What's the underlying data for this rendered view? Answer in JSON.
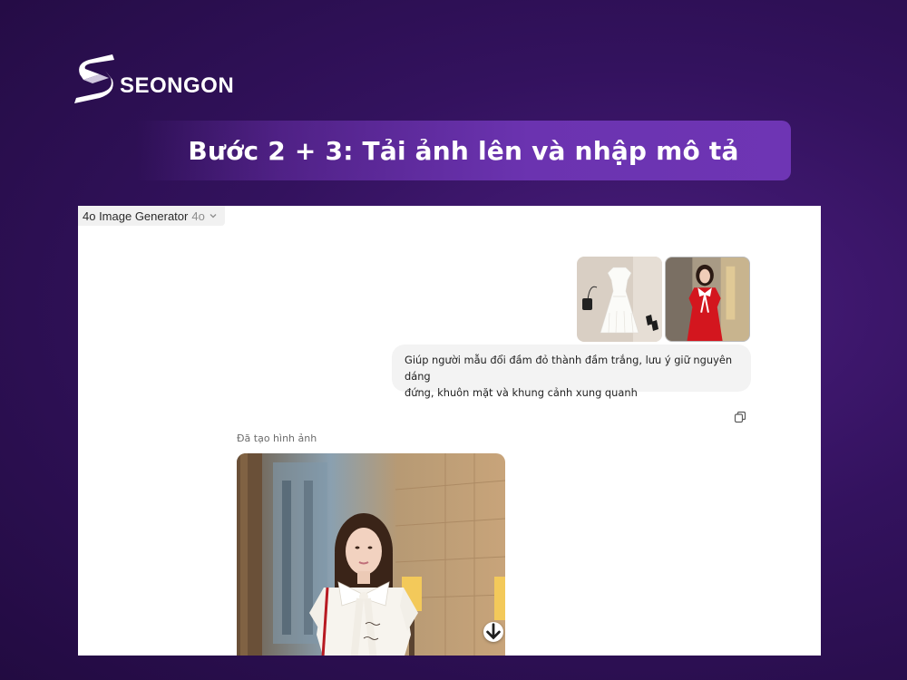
{
  "brand": {
    "name": "SEONGON",
    "logo_icon": "seongon-s-logo"
  },
  "banner": {
    "title": "Bước 2 + 3: Tải ảnh lên và nhập mô tả"
  },
  "chat": {
    "model_selector": {
      "name": "4o Image Generator",
      "version": "4o",
      "icon": "chevron-down-icon"
    },
    "attachments": [
      "white-dress-product-photo",
      "model-in-red-dress-photo"
    ],
    "user_message": {
      "line1": "Giúp người mẫu đổi đầm đỏ thành đầm trắng, lưu ý giữ nguyên dáng",
      "line2": "đứng, khuôn mặt và khung cảnh xung quanh"
    },
    "copy_icon": "copy-icon",
    "generated_label": "Đã tạo hình ảnh",
    "generated_image": "model-in-white-dress-generated",
    "download_icon": "download-arrow-icon"
  },
  "colors": {
    "background": "#33125e",
    "banner": "#6b33b0",
    "panel": "#ffffff",
    "bubble": "#f3f3f3"
  }
}
